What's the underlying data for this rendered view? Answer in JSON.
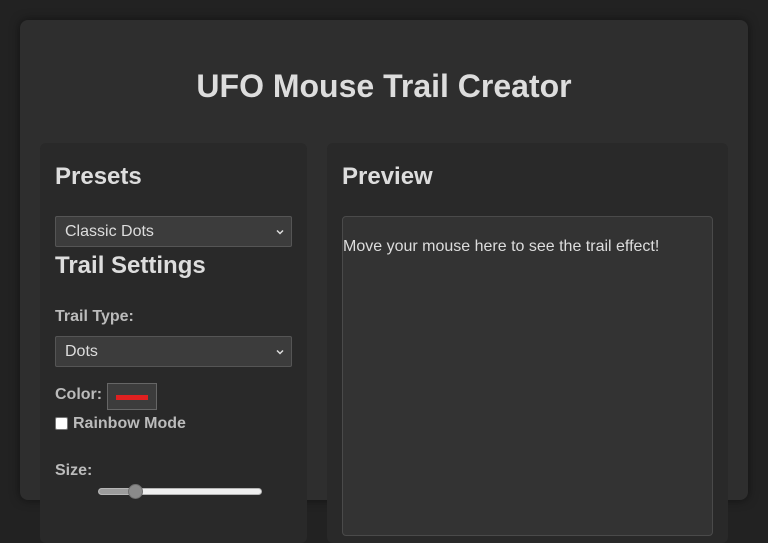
{
  "app": {
    "title": "UFO Mouse Trail Creator"
  },
  "presets": {
    "heading": "Presets",
    "selected": "Classic Dots"
  },
  "trail_settings": {
    "heading": "Trail Settings",
    "trail_type_label": "Trail Type:",
    "trail_type_selected": "Dots",
    "color_label": "Color:",
    "color_value": "#e02020",
    "rainbow_label": "Rainbow Mode",
    "rainbow_checked": false,
    "size_label": "Size:",
    "size_level_fraction": 0.2
  },
  "preview": {
    "heading": "Preview",
    "hint": "Move your mouse here to see the trail effect!"
  },
  "icons": {
    "select_arrow": "chevron-down-icon"
  }
}
